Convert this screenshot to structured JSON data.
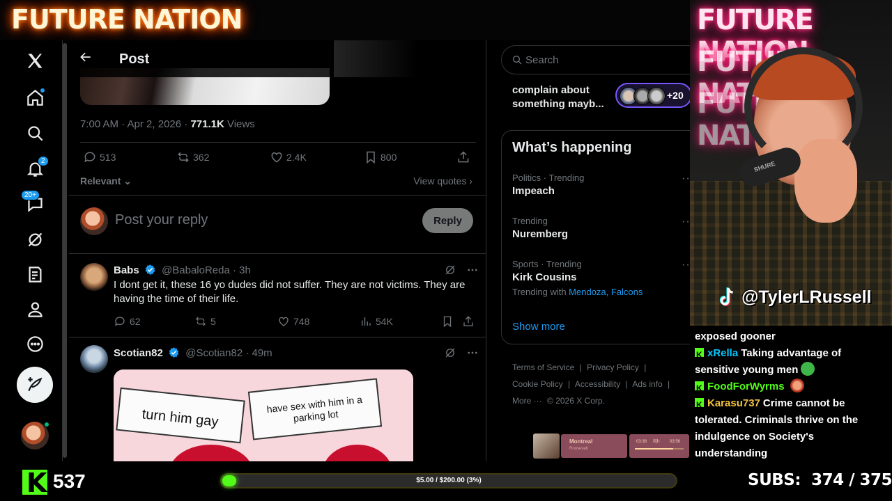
{
  "overlay": {
    "brand": "FUTURE NATION",
    "tiktok_handle": "@TylerLRussell",
    "viewer_count": "537",
    "goal_text": "$5.00 / $200.00 (3%)",
    "goal_progress": 0.03,
    "subs_label": "SUBS:",
    "subs_value": "374 / 375",
    "cam_mic_label": "SHURE",
    "kick_color": "#53fc18"
  },
  "nav": {
    "items": [
      {
        "icon": "x-logo-icon"
      },
      {
        "icon": "home-icon"
      },
      {
        "icon": "explore-icon"
      },
      {
        "icon": "notifications-icon",
        "badge": "2"
      },
      {
        "icon": "messages-icon",
        "badge": "20+"
      },
      {
        "icon": "grok-icon"
      },
      {
        "icon": "lists-icon"
      },
      {
        "icon": "profile-icon"
      },
      {
        "icon": "more-icon"
      },
      {
        "icon": "compose-icon"
      }
    ]
  },
  "post": {
    "header_title": "Post",
    "time": "7:00 AM · Apr 2, 2026 · ",
    "views_count": "771.1K",
    "views_label": " Views",
    "stats": {
      "replies": "513",
      "reposts": "362",
      "likes": "2.4K",
      "bookmarks": "800"
    },
    "sort_label": "Relevant",
    "view_quotes": "View quotes",
    "reply_placeholder": "Post your reply",
    "reply_button": "Reply"
  },
  "replies": [
    {
      "name": "Babs",
      "handle": "@BabaloReda · 3h",
      "text": "I dont get it, these 16 yo dudes did not suffer. They are not victims. They are having the time of their life.",
      "replies": "62",
      "reposts": "5",
      "likes": "748",
      "views": "54K"
    },
    {
      "name": "Scotian82",
      "handle": "@Scotian82 · 49m",
      "meme_left": "turn him gay",
      "meme_right": "have sex with him in a parking lot"
    }
  ],
  "sidebar": {
    "search_placeholder": "Search",
    "space_title": "complain about something mayb...",
    "space_count": "+20",
    "happening_title": "What’s happening",
    "trends": [
      {
        "meta": "Politics · Trending",
        "name": "Impeach"
      },
      {
        "meta": "Trending",
        "name": "Nuremberg"
      },
      {
        "meta": "Sports · Trending",
        "name": "Kirk Cousins",
        "with_label": "Trending with ",
        "with_links": "Mendoza, Falcons"
      }
    ],
    "show_more": "Show more",
    "footer": [
      "Terms of Service",
      "|",
      "Privacy Policy",
      "|",
      "Cookie Policy",
      "|",
      "Accessibility",
      "|",
      "Ads info",
      "|",
      "More ···",
      "© 2026 X Corp."
    ]
  },
  "player": {
    "track": "Montreal",
    "artist": "Roosevelt",
    "time_elapsed": "03:38",
    "time_total": "03:56",
    "progress": 0.78
  },
  "chat": [
    {
      "user": "",
      "text": "exposed gooner",
      "color": "#ffffff"
    },
    {
      "user": "xRella",
      "text": "Taking advantage of sensitive young men",
      "color": "#00c8ff",
      "emote": "sick-emote"
    },
    {
      "user": "FoodForWyrms",
      "text": "",
      "color": "#53fc18",
      "emote": "face-emote"
    },
    {
      "user": "Karasu737",
      "text": "Crime cannot be tolerated. Criminals thrive on the indulgence on Society's understanding",
      "color": "#f5c542"
    }
  ]
}
